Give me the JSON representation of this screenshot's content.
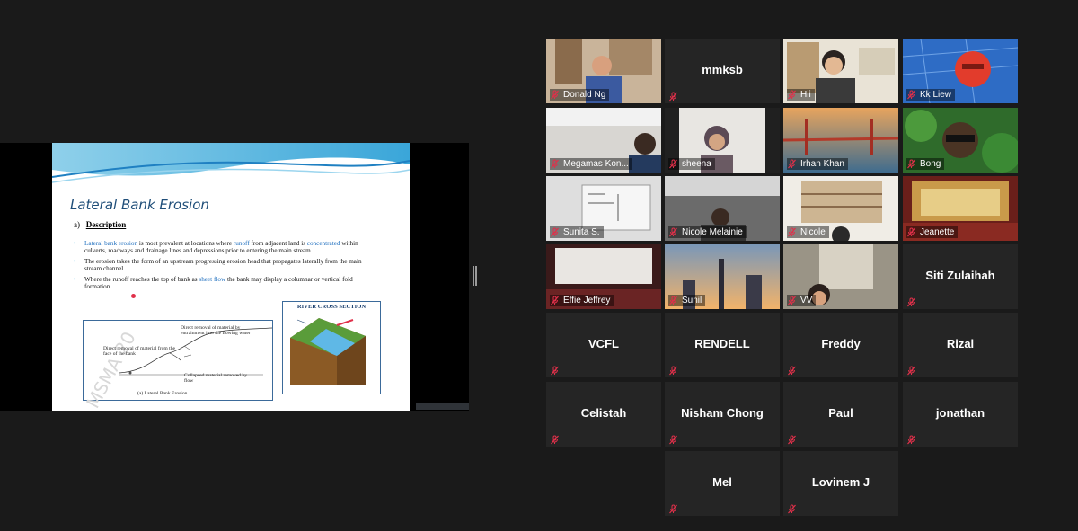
{
  "slide": {
    "title": "Lateral Bank Erosion",
    "subtitle_prefix": "a)",
    "subtitle": "Description",
    "bullet1_a": "Lateral bank erosion",
    "bullet1_b": " is most prevalent at locations where ",
    "bullet1_c": "runoff",
    "bullet1_d": " from adjacent land is ",
    "bullet1_e": "concentrated",
    "bullet1_f": " within culverts, roadways and drainage lines and depressions prior to entering the main stream",
    "bullet2": "The erosion takes the form of an upstream progressing erosion head that propagates laterally from the main stream channel",
    "bullet3_a": "Where the runoff reaches the top of bank as ",
    "bullet3_b": "sheet flow",
    "bullet3_c": " the bank may display a columnar or vertical fold formation",
    "fig1": {
      "label1": "Direct removal of material by entrainment into the flowing water",
      "label2": "Direct removal of material from the face of the bank",
      "label3": "Collapsed material removed by flow",
      "caption": "(a) Lateral Bank Erosion",
      "watermark": "MSMA 20"
    },
    "fig2": {
      "title": "RIVER CROSS SECTION"
    }
  },
  "participants": [
    {
      "name": "Donald Ng",
      "video": true
    },
    {
      "name": "mmksb",
      "video": false
    },
    {
      "name": "Hii",
      "video": true,
      "active": true
    },
    {
      "name": "Kk Liew",
      "video": true
    },
    {
      "name": "Megamas Kon...",
      "video": true
    },
    {
      "name": "sheena",
      "video": true
    },
    {
      "name": "Irhan Khan",
      "video": true
    },
    {
      "name": "Bong",
      "video": true
    },
    {
      "name": "Sunita S.",
      "video": true
    },
    {
      "name": "Nicole Melainie",
      "video": true
    },
    {
      "name": "Nicole",
      "video": true
    },
    {
      "name": "Jeanette",
      "video": true
    },
    {
      "name": "Effie Jeffrey",
      "video": true
    },
    {
      "name": "Sunil",
      "video": true
    },
    {
      "name": "VV",
      "video": true
    },
    {
      "name": "Siti Zulaihah",
      "video": false
    },
    {
      "name": "VCFL",
      "video": false
    },
    {
      "name": "RENDELL",
      "video": false
    },
    {
      "name": "Freddy",
      "video": false
    },
    {
      "name": "Rizal",
      "video": false
    },
    {
      "name": "Celistah",
      "video": false
    },
    {
      "name": "Nisham Chong",
      "video": false
    },
    {
      "name": "Paul",
      "video": false
    },
    {
      "name": "jonathan",
      "video": false
    },
    {
      "name": "Mel",
      "video": false
    },
    {
      "name": "Lovinem J",
      "video": false
    }
  ],
  "colors": {
    "muted_mic": "#e0304a",
    "active_border": "#a9d36a",
    "tile_bg": "#252525"
  }
}
